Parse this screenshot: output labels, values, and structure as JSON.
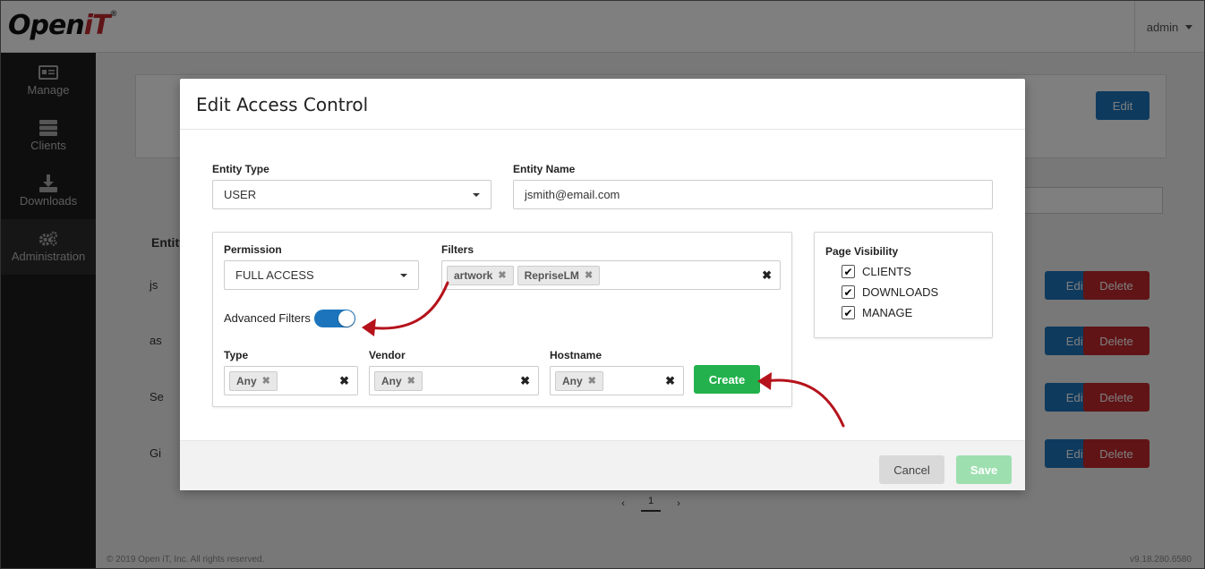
{
  "app": {
    "logo_main": "Open",
    "logo_it": "iT",
    "logo_reg": "®",
    "user": "admin",
    "sidebar": [
      {
        "label": "Manage",
        "icon": "id-card-icon"
      },
      {
        "label": "Clients",
        "icon": "server-icon"
      },
      {
        "label": "Downloads",
        "icon": "download-icon"
      },
      {
        "label": "Administration",
        "icon": "cogs-icon"
      }
    ],
    "edit_label": "Edit",
    "delete_label": "Delete",
    "entity_label": "Entity",
    "rows": [
      {
        "name": "js"
      },
      {
        "name": "as"
      },
      {
        "name": "Se"
      },
      {
        "name": "Gi"
      }
    ],
    "pager": {
      "prev": "‹",
      "current": "1",
      "next": "›"
    },
    "footer_left": "© 2019 Open iT, Inc. All rights reserved.",
    "footer_right": "v9.18.280.6580"
  },
  "modal": {
    "title": "Edit Access Control",
    "entity_type": {
      "label": "Entity Type",
      "value": "USER"
    },
    "entity_name": {
      "label": "Entity Name",
      "value": "jsmith@email.com"
    },
    "permission": {
      "label": "Permission",
      "value": "FULL ACCESS"
    },
    "filters": {
      "label": "Filters",
      "tags": [
        "artwork",
        "RepriseLM"
      ]
    },
    "advanced_filters": {
      "label": "Advanced Filters",
      "enabled": true
    },
    "type": {
      "label": "Type",
      "tag": "Any"
    },
    "vendor": {
      "label": "Vendor",
      "tag": "Any"
    },
    "hostname": {
      "label": "Hostname",
      "tag": "Any"
    },
    "create_label": "Create",
    "page_visibility": {
      "title": "Page Visibility",
      "items": [
        {
          "label": "CLIENTS",
          "checked": true
        },
        {
          "label": "DOWNLOADS",
          "checked": true
        },
        {
          "label": "MANAGE",
          "checked": true
        }
      ]
    },
    "cancel_label": "Cancel",
    "save_label": "Save"
  },
  "colors": {
    "primary": "#1c75bc",
    "danger": "#c0282d",
    "success": "#22b14c",
    "save_disabled": "#9edfb0",
    "annotation_arrow": "#b5121b"
  }
}
